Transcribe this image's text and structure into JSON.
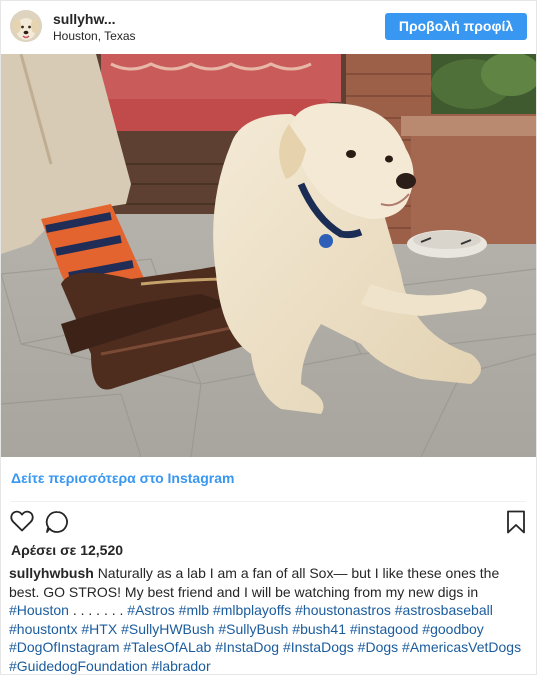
{
  "header": {
    "username": "sullyhw...",
    "location": "Houston, Texas",
    "view_profile_label": "Προβολή προφίλ"
  },
  "icons": {
    "avatar": "dog-avatar",
    "like": "heart-icon",
    "comment": "comment-icon",
    "save": "bookmark-icon"
  },
  "photo": {
    "subject": "labrador-with-socks-photo"
  },
  "see_more_label": "Δείτε περισσότερα στο Instagram",
  "likes_text": "Αρέσει σε 12,520",
  "caption": {
    "username": "sullyhwbush",
    "text": "Naturally as a lab I am a fan of all Sox— but I like these ones the best. GO STROS! My best friend and I will be watching from my new digs in",
    "dots": ". . . . . . .",
    "hashtags": [
      "#Houston",
      "#Astros",
      "#mlb",
      "#mlbplayoffs",
      "#houstonastros",
      "#astrosbaseball",
      "#houstontx",
      "#HTX",
      "#SullyHWBush",
      "#SullyBush",
      "#bush41",
      "#instagood",
      "#goodboy",
      "#DogOfInstagram",
      "#TalesOfALab",
      "#InstaDog",
      "#InstaDogs",
      "#Dogs",
      "#AmericasVetDogs",
      "#GuidedogFoundation",
      "#labrador"
    ]
  },
  "colors": {
    "accent": "#3897f0",
    "hashtag": "#1b5c9d",
    "text": "#262626"
  }
}
